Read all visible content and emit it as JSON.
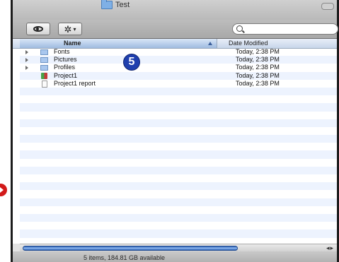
{
  "window": {
    "title": "Test"
  },
  "toolbar": {
    "view_icon": "eye-icon",
    "action_icon": "gear-icon",
    "action_chevron": "▾",
    "search_placeholder": ""
  },
  "columns": {
    "name": "Name",
    "date": "Date Modified"
  },
  "rows": [
    {
      "name": "Fonts",
      "date": "Today, 2:38 PM",
      "kind": "folder",
      "expandable": true
    },
    {
      "name": "Pictures",
      "date": "Today, 2:38 PM",
      "kind": "folder",
      "expandable": true
    },
    {
      "name": "Profiles",
      "date": "Today, 2:38 PM",
      "kind": "folder",
      "expandable": true
    },
    {
      "name": "Project1",
      "date": "Today, 2:38 PM",
      "kind": "project",
      "expandable": false
    },
    {
      "name": "Project1 report",
      "date": "Today, 2:38 PM",
      "kind": "document",
      "expandable": false
    }
  ],
  "status": {
    "text": "5 items, 184.81 GB available"
  },
  "callout": {
    "number": "5"
  },
  "colors": {
    "accent": "#1f3fae",
    "scroll_thumb": "#3a6fc2",
    "arrow": "#d21a1a"
  }
}
